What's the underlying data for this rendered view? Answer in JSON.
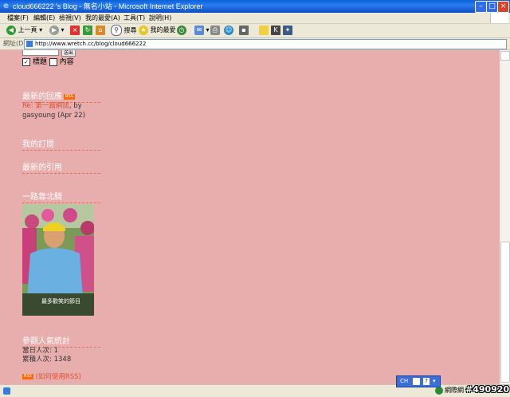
{
  "window": {
    "title": "cloud666222 's Blog - 無名小站 - Microsoft Internet Explorer",
    "minimize": "–",
    "maximize": "□",
    "close": "×"
  },
  "menu": [
    "檔案(F)",
    "編輯(E)",
    "檢視(V)",
    "我的最愛(A)",
    "工具(T)",
    "說明(H)"
  ],
  "toolbar": {
    "back_label": "上一頁",
    "search_label": "搜尋",
    "favorites_label": "我的最愛"
  },
  "address": {
    "label": "網址(D)",
    "url": "http://www.wretch.cc/blog/cloud666222"
  },
  "sidebar": {
    "search_button": "送出",
    "check_title": "標題",
    "check_content": "內容",
    "recent_comments": {
      "title": "最新的回應",
      "rss": "RSS",
      "comment_link": "Re: 第一篇網誌",
      "comment_by": ", by",
      "comment_meta": "gasyoung (Apr 22)"
    },
    "subscriptions_title": "我的訂閱",
    "trackbacks_title": "最新的引用",
    "album_title": "一路靠北騎",
    "photo_caption": "最多歡笑的節目",
    "visitors": {
      "title": "參觀人氣統計",
      "today_label": "當日人次",
      "today_value": "1",
      "total_label": "累積人次",
      "total_value": "1348"
    },
    "rss_badge": "RSS",
    "rss_help": "(如何使用RSS)"
  },
  "statusbar": {
    "ime_lang": "CH",
    "zone": "網際網",
    "watermark": "#490920"
  }
}
